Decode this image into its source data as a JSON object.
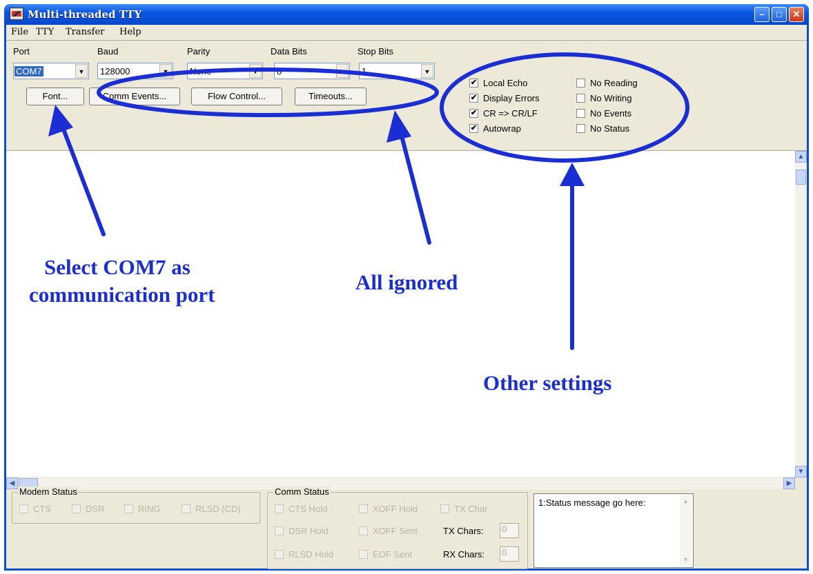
{
  "window": {
    "title": "Multi-threaded TTY"
  },
  "menu": [
    "File",
    "TTY",
    "Transfer",
    "Help"
  ],
  "settings": {
    "port": {
      "label": "Port",
      "value": "COM7"
    },
    "baud": {
      "label": "Baud",
      "value": "128000"
    },
    "parity": {
      "label": "Parity",
      "value": "None"
    },
    "data_bits": {
      "label": "Data Bits",
      "value": "8"
    },
    "stop_bits": {
      "label": "Stop Bits",
      "value": "1"
    }
  },
  "buttons": [
    "Font...",
    "Comm Events...",
    "Flow Control...",
    "Timeouts..."
  ],
  "options_left": [
    {
      "label": "Local Echo",
      "checked": true
    },
    {
      "label": "Display Errors",
      "checked": true
    },
    {
      "label": "CR => CR/LF",
      "checked": true
    },
    {
      "label": "Autowrap",
      "checked": true
    }
  ],
  "options_right": [
    {
      "label": "No Reading",
      "checked": false
    },
    {
      "label": "No Writing",
      "checked": false
    },
    {
      "label": "No Events",
      "checked": false
    },
    {
      "label": "No Status",
      "checked": false
    }
  ],
  "modem_status": {
    "title": "Modem Status",
    "items": [
      "CTS",
      "DSR",
      "RING",
      "RLSD (CD)"
    ]
  },
  "comm_status": {
    "title": "Comm Status",
    "items": [
      "CTS Hold",
      "XOFF Hold",
      "TX Char",
      "DSR Hold",
      "XOFF Sent",
      "RLSD Hold",
      "EOF Sent"
    ],
    "tx_chars_label": "TX Chars:",
    "tx_chars_value": "0",
    "rx_chars_label": "RX Chars:",
    "rx_chars_value": "0"
  },
  "status_message": "1:Status message go here:",
  "annotations": {
    "port": [
      "Select COM7 as",
      "communication port"
    ],
    "ignored": "All ignored",
    "other": "Other settings",
    "color": "#1a2ed3"
  }
}
